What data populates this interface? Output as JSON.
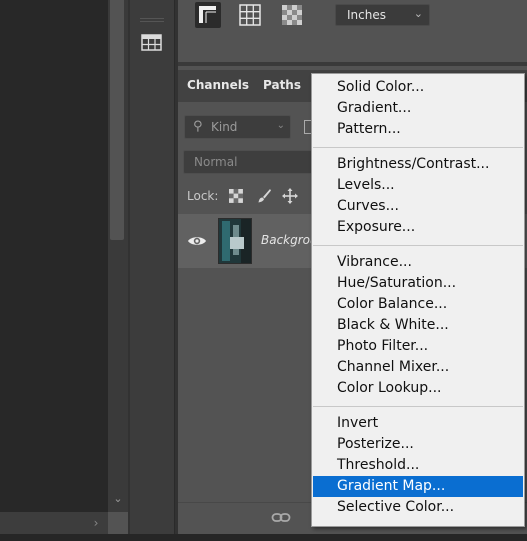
{
  "toolbar": {
    "units": "Inches",
    "icons": [
      "corner-crop-icon",
      "grid-icon",
      "checkerboard-icon",
      "table-icon"
    ]
  },
  "panel": {
    "tabs": [
      {
        "label": "Channels"
      },
      {
        "label": "Paths"
      }
    ],
    "kind_filter": "Kind",
    "blend_mode": "Normal",
    "lock_label": "Lock:",
    "layer_name": "Background"
  },
  "menu": {
    "items": [
      "Solid Color...",
      "Gradient...",
      "Pattern...",
      "Brightness/Contrast...",
      "Levels...",
      "Curves...",
      "Exposure...",
      "Vibrance...",
      "Hue/Saturation...",
      "Color Balance...",
      "Black & White...",
      "Photo Filter...",
      "Channel Mixer...",
      "Color Lookup...",
      "Invert",
      "Posterize...",
      "Threshold...",
      "Gradient Map...",
      "Selective Color..."
    ],
    "selected": "Gradient Map..."
  },
  "colors": {
    "highlight": "#0a6ed1",
    "menu_bg": "#f0f0f0",
    "panel_bg": "#535353"
  }
}
